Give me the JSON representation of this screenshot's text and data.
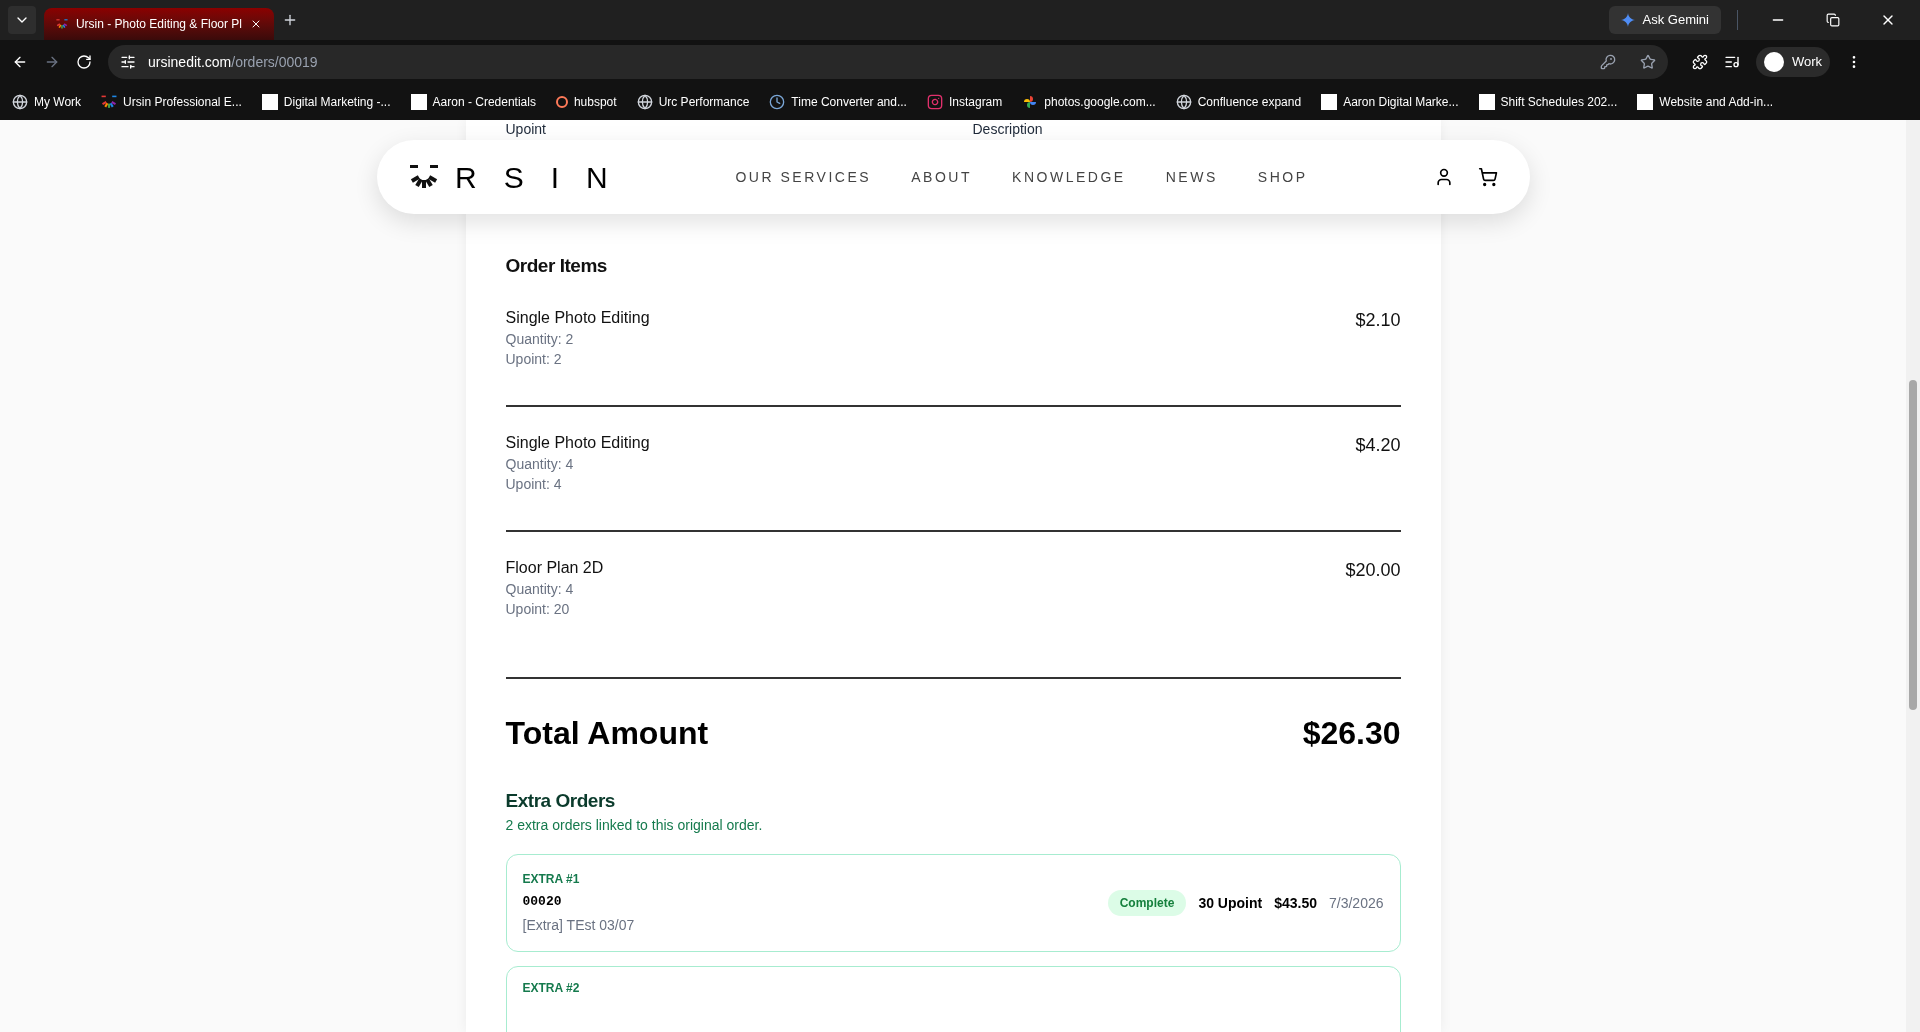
{
  "browser": {
    "tab": {
      "title": "Ursin - Photo Editing & Floor Pl",
      "selected": true
    },
    "ask_button": "Ask Gemini",
    "url": {
      "host": "ursinedit.com",
      "path": "/orders/00019"
    },
    "profile": "Work",
    "bookmarks": [
      {
        "kind": "globe",
        "label": "My Work"
      },
      {
        "kind": "logo",
        "label": "Ursin Professional E..."
      },
      {
        "kind": "id",
        "label": "Digital Marketing -..."
      },
      {
        "kind": "id",
        "label": "Aaron - Credentials"
      },
      {
        "kind": "hub",
        "label": "hubspot"
      },
      {
        "kind": "globe",
        "label": "Urc Performance"
      },
      {
        "kind": "clock",
        "label": "Time Converter and..."
      },
      {
        "kind": "insta",
        "label": "Instagram"
      },
      {
        "kind": "pinwheel",
        "label": "photos.google.com..."
      },
      {
        "kind": "globe",
        "label": "Confluence expand"
      },
      {
        "kind": "id",
        "label": "Aaron Digital Marke..."
      },
      {
        "kind": "id",
        "label": "Shift Schedules 202..."
      },
      {
        "kind": "id",
        "label": "Website and Add-in..."
      }
    ]
  },
  "behind_header": [
    "Upoint",
    "Description"
  ],
  "header": {
    "logo": "RSIN",
    "nav": [
      "OUR SERVICES",
      "ABOUT",
      "KNOWLEDGE",
      "NEWS",
      "SHOP"
    ]
  },
  "order_items": {
    "title": "Order Items",
    "items": [
      {
        "name": "Single Photo Editing",
        "quantity": "Quantity: 2",
        "upoint": "Upoint: 2",
        "price": "$2.10"
      },
      {
        "name": "Single Photo Editing",
        "quantity": "Quantity: 4",
        "upoint": "Upoint: 4",
        "price": "$4.20"
      },
      {
        "name": "Floor Plan 2D",
        "quantity": "Quantity: 4",
        "upoint": "Upoint: 20",
        "price": "$20.00"
      }
    ]
  },
  "total": {
    "label": "Total Amount",
    "value": "$26.30"
  },
  "extra_orders": {
    "title": "Extra Orders",
    "subtitle": "2 extra orders linked to this original order.",
    "orders": [
      {
        "label": "EXTRA #1",
        "number": "00020",
        "description": "[Extra] TEst 03/07",
        "status": "Complete",
        "upoint": "30 Upoint",
        "price": "$43.50",
        "date": "7/3/2026"
      },
      {
        "label": "EXTRA #2"
      }
    ]
  }
}
